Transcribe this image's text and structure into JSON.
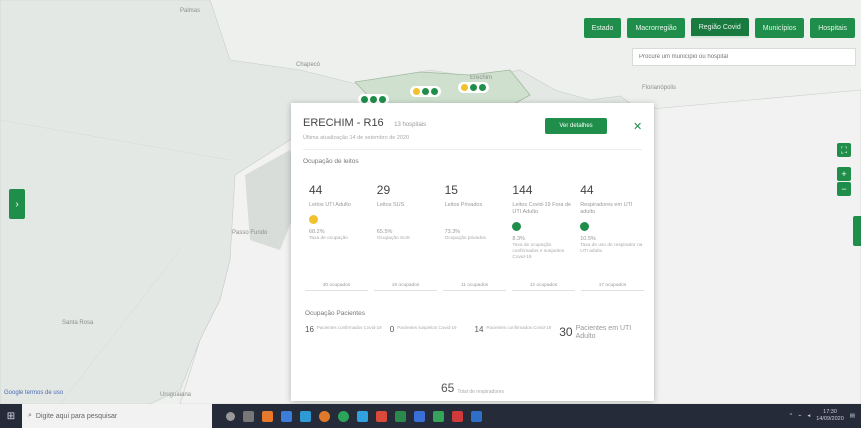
{
  "nav": {
    "buttons": [
      "Estado",
      "Macrorregião",
      "Região Covid",
      "Municípios",
      "Hospitais"
    ],
    "active_index": 2
  },
  "search": {
    "placeholder": "Procure um município ou hospital"
  },
  "map": {
    "labels": [
      "Palmas",
      "Chapecó",
      "Erechim",
      "Florianópolis",
      "Santa Rosa",
      "Passo Fundo",
      "Uruguaiana"
    ]
  },
  "panel": {
    "title": "ERECHIM - R16",
    "subtitle": "13 hospitais",
    "date": "Última atualização 14 de setembro de 2020",
    "details_label": "Ver detalhes",
    "close_label": "✕",
    "section_beds": "Ocupação de leitos",
    "stats": [
      {
        "value": "44",
        "label": "Leitos UTI Adulto",
        "dot_color": "#f2c12e",
        "pct": "68.2%",
        "pct_label": "Taxa de ocupação"
      },
      {
        "value": "29",
        "label": "Leitos SUS",
        "dot_color": "",
        "pct": "65.5%",
        "pct_label": "Ocupação SUS"
      },
      {
        "value": "15",
        "label": "Leitos Privados",
        "dot_color": "",
        "pct": "73.3%",
        "pct_label": "Ocupação privados"
      },
      {
        "value": "144",
        "label": "Leitos Covid-19 Fora de UTI Adulto",
        "dot_color": "#1f8e4a",
        "pct": "8.3%",
        "pct_label": "Taxa de ocupação confirmados e suspeitos Covid-19"
      },
      {
        "value": "44",
        "label": "Respiradores em UTI adulto",
        "dot_color": "#1f8e4a",
        "pct": "10.5%",
        "pct_label": "Taxa de uso de respirador na UTI adulto"
      }
    ],
    "occupied": [
      "30 ocupados",
      "19 ocupados",
      "11 ocupados",
      "12 ocupados",
      "17 ocupados"
    ],
    "section_patients": "Ocupação Pacientes",
    "patients": [
      {
        "value": "16",
        "label": "Pacientes confirmados Covid-19"
      },
      {
        "value": "0",
        "label": "Pacientes suspeitos Covid-19"
      },
      {
        "value": "14",
        "label": "Pacientes confirmados Covid-19"
      }
    ],
    "icu_patients": {
      "value": "30",
      "label": "Pacientes em UTI Adulto"
    },
    "total": {
      "value": "65",
      "label": "Total de respiradores"
    }
  },
  "google_link": "Google termos de uso",
  "taskbar": {
    "search_placeholder": "Digite aqui para pesquisar",
    "time": "17:30",
    "date": "14/09/2020"
  }
}
